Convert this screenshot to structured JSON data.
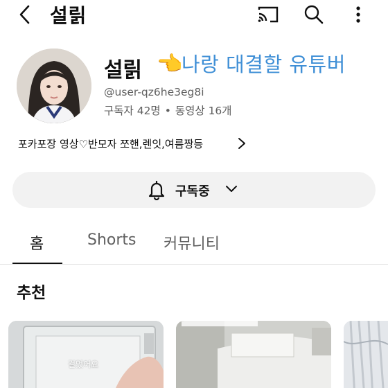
{
  "header": {
    "title": "설릵",
    "icons": [
      "back-arrow-icon",
      "cast-icon",
      "search-icon",
      "more-vert-icon"
    ]
  },
  "channel": {
    "name": "설릵",
    "overlay_text": "나랑 대결할 유튜버",
    "pointer_emoji": "👈",
    "handle": "@user-qz6he3eg8i",
    "subscribers": "구독자 42명",
    "separator": "•",
    "videos": "동영상 16개",
    "description": "포카포장 영상♡반모자 쪼핸,렌잇,여름짱등"
  },
  "subscribe": {
    "label": "구독중"
  },
  "tabs": [
    {
      "label": "홈",
      "active": true
    },
    {
      "label": "Shorts",
      "active": false
    },
    {
      "label": "커뮤니티",
      "active": false
    }
  ],
  "sections": {
    "recommended_title": "추천"
  },
  "thumbnails": [
    {
      "caption": "걸었어요"
    },
    {
      "caption": ""
    },
    {
      "caption": ""
    }
  ],
  "colors": {
    "overlay_text": "#3f8fd6",
    "secondary_text": "#606060",
    "button_bg": "#f2f2f2"
  }
}
